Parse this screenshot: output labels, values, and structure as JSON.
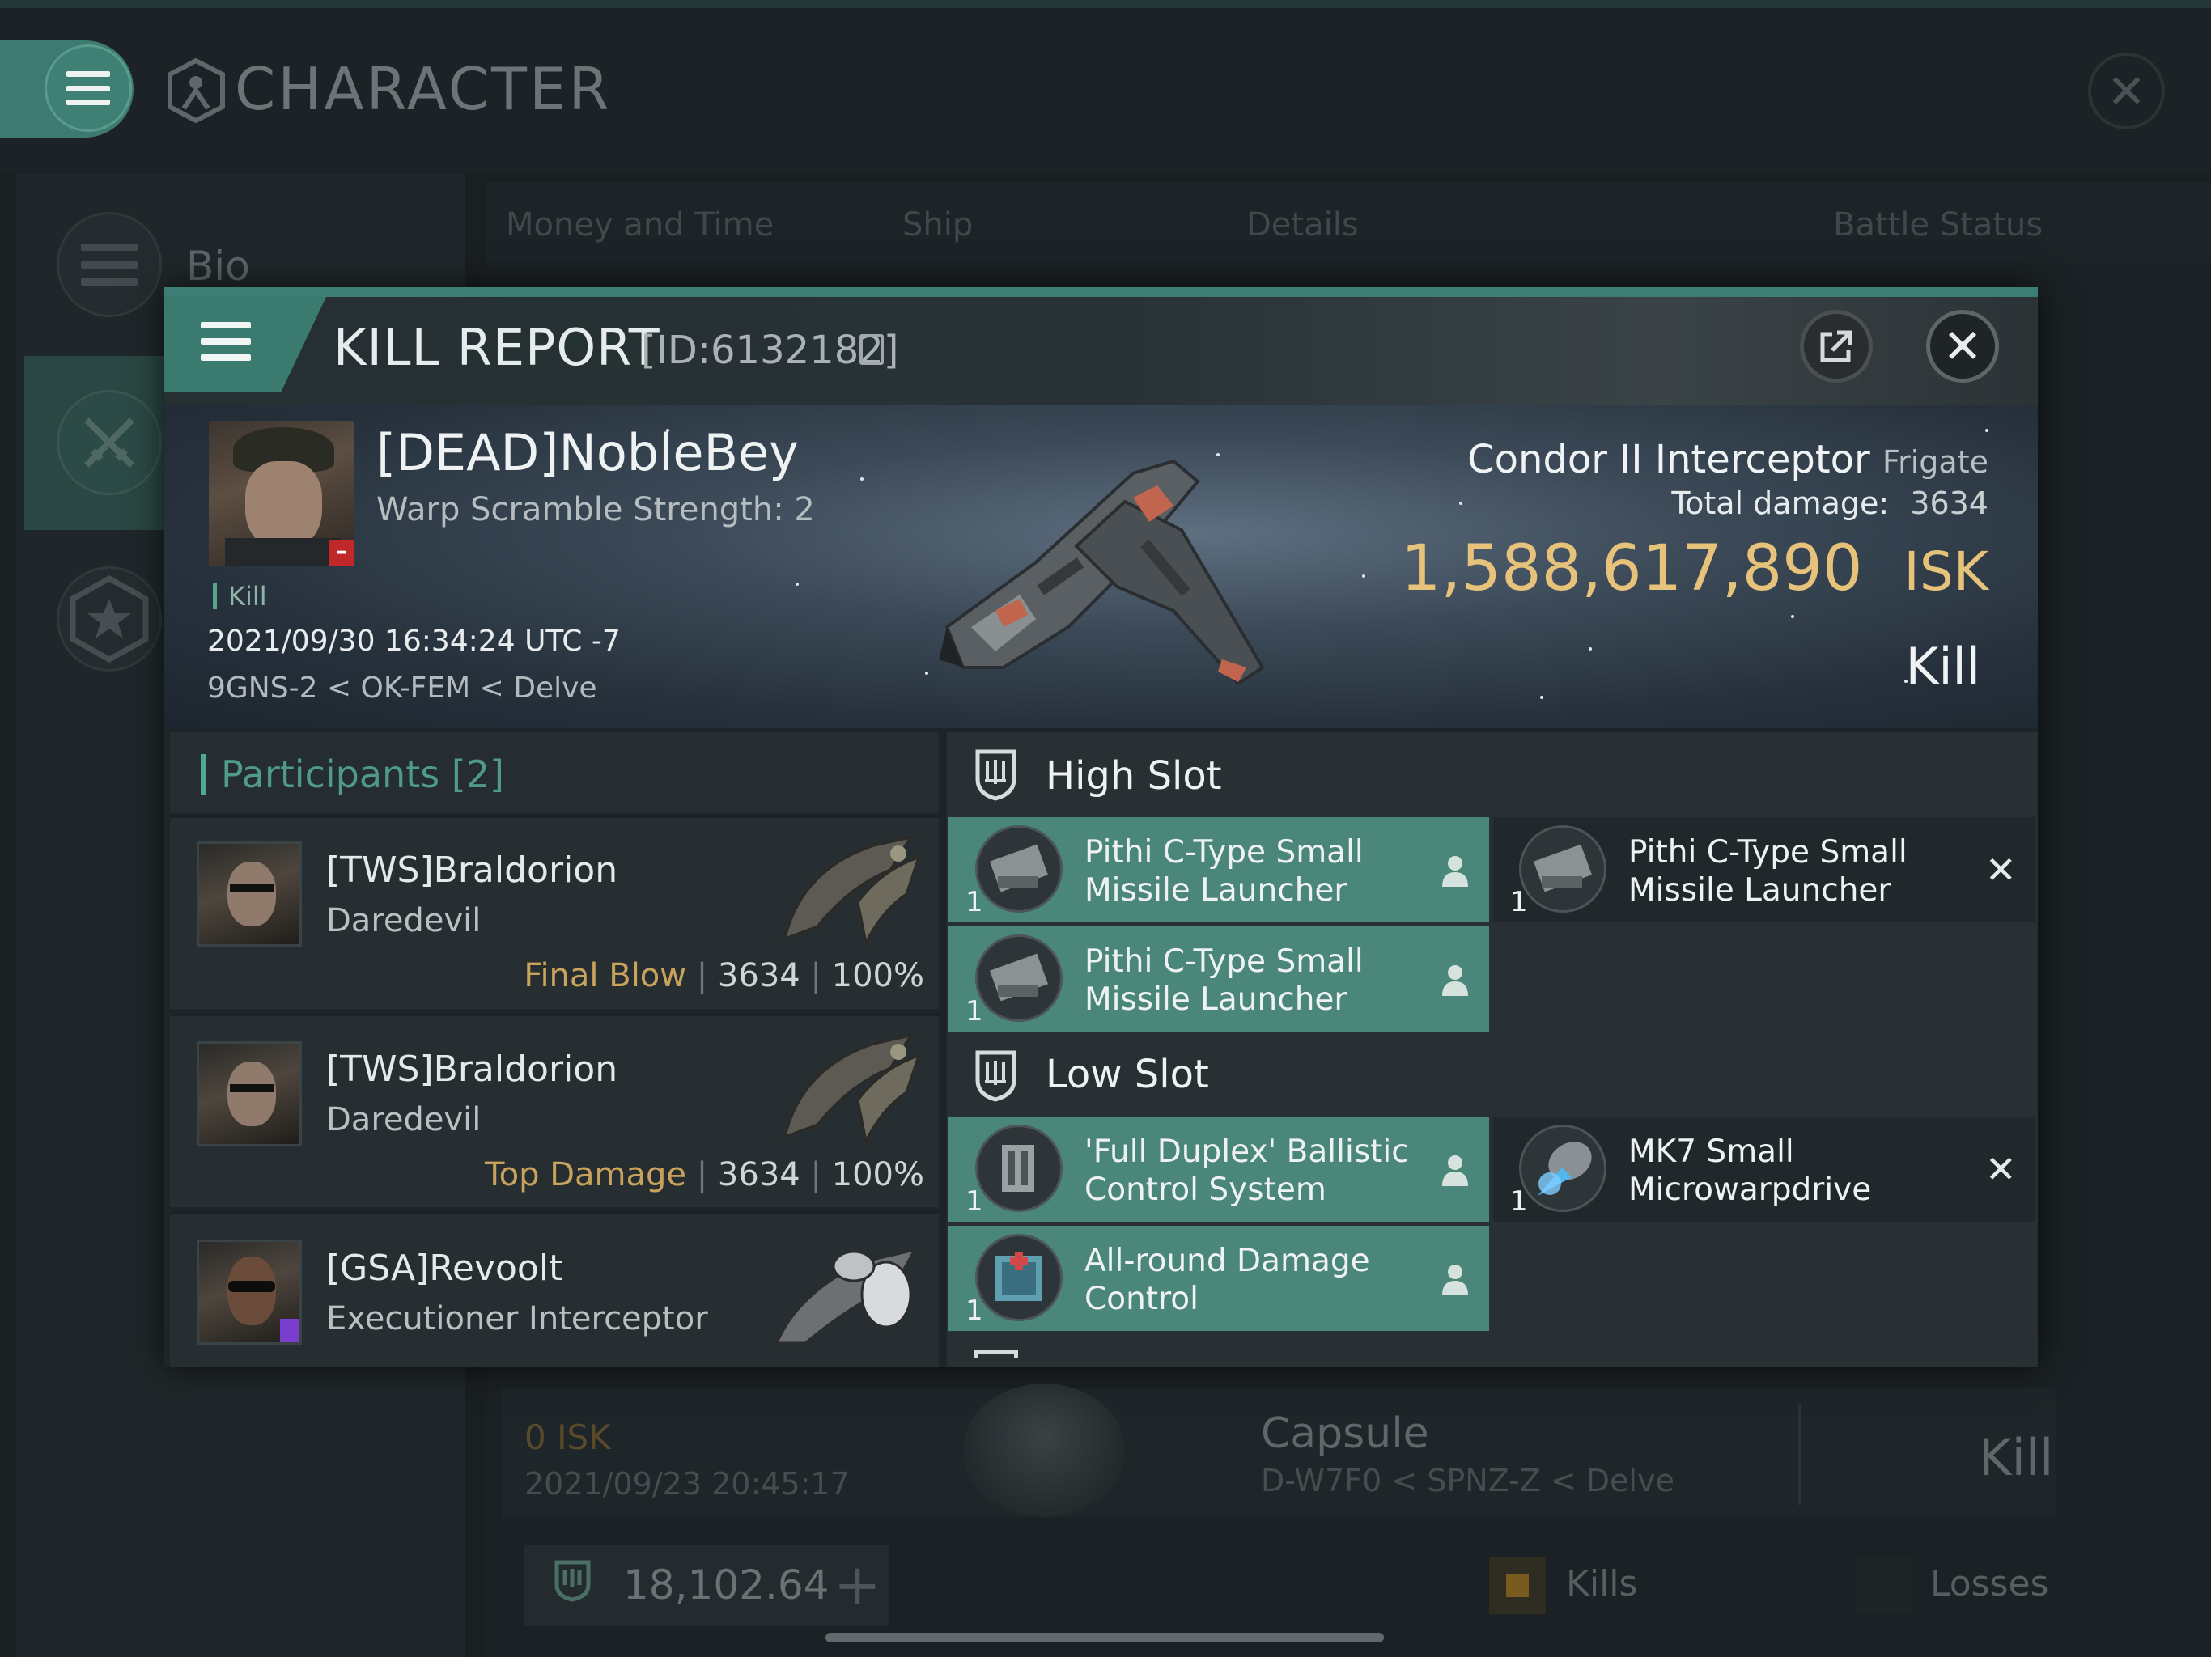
{
  "background": {
    "title": "CHARACTER",
    "sidebar": {
      "bio_label": "Bio"
    },
    "tabs": [
      "Money and Time",
      "Ship",
      "Details",
      "Battle Status"
    ],
    "row": {
      "isk": "0  ISK",
      "date": "2021/09/23  20:45:17",
      "ship": "Capsule",
      "location": "D-W7F0 < SPNZ-Z < Delve",
      "result": "Kill"
    },
    "wallet": {
      "value": "18,102.64"
    },
    "legend": {
      "kills": "Kills",
      "losses": "Losses"
    }
  },
  "kill_report": {
    "title": "KILL REPORT",
    "id": "[ID:6132182]",
    "victim": {
      "name": "[DEAD]NobleBey",
      "warp_scramble": "Warp Scramble Strength: 2",
      "tag": "Kill",
      "datetime": "2021/09/30 16:34:24 UTC -7",
      "location": "9GNS-2 < OK-FEM < Delve",
      "badge": "–"
    },
    "ship": {
      "name": "Condor II Interceptor",
      "class": "Frigate",
      "total_damage_label": "Total damage:",
      "total_damage": "3634",
      "isk_value": "1,588,617,890",
      "isk_unit": "ISK",
      "result": "Kill"
    },
    "participants": {
      "header": "Participants",
      "count": "[2]",
      "list": [
        {
          "name": "[TWS]Braldorion",
          "ship": "Daredevil",
          "tag": "Final Blow",
          "damage": "3634",
          "percent": "100%"
        },
        {
          "name": "[TWS]Braldorion",
          "ship": "Daredevil",
          "tag": "Top Damage",
          "damage": "3634",
          "percent": "100%"
        },
        {
          "name": "[GSA]Revoolt",
          "ship": "Executioner Interceptor"
        }
      ]
    },
    "fitting": {
      "high_slot": {
        "label": "High Slot",
        "modules": [
          {
            "line1": "Pithi C-Type Small",
            "line2": "Missile Launcher",
            "qty": "1",
            "state": "dropped"
          },
          {
            "line1": "Pithi C-Type Small",
            "line2": "Missile Launcher",
            "qty": "1",
            "state": "destroyed"
          },
          {
            "line1": "Pithi C-Type Small",
            "line2": "Missile Launcher",
            "qty": "1",
            "state": "dropped"
          }
        ]
      },
      "low_slot": {
        "label": "Low Slot",
        "modules": [
          {
            "line1": "'Full Duplex' Ballistic",
            "line2": "Control System",
            "qty": "1",
            "state": "dropped"
          },
          {
            "line1": "MK7 Small",
            "line2": "Microwarpdrive",
            "qty": "1",
            "state": "destroyed"
          },
          {
            "line1": "All-round Damage",
            "line2": "Control",
            "qty": "1",
            "state": "dropped"
          }
        ]
      }
    }
  },
  "colors": {
    "accent_teal": "#3e7d73",
    "isk_gold": "#e7c27a",
    "final_blow_gold": "#c9a35c",
    "dead_red": "#c0282a"
  },
  "icons": {
    "menu": "hamburger-icon",
    "character": "character-emblem-icon",
    "close": "close-icon",
    "share": "external-link-icon",
    "copy": "copy-icon",
    "slot": "slot-shield-icon",
    "person": "person-icon",
    "destroyed": "x-icon"
  }
}
